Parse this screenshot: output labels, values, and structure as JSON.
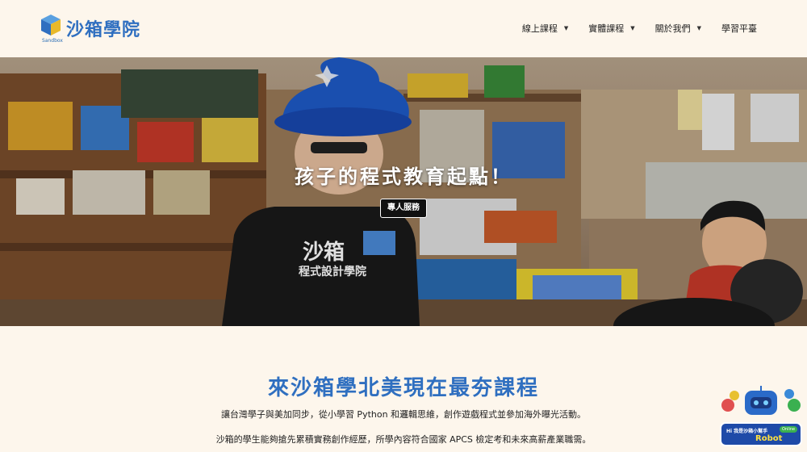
{
  "brand": {
    "name_part1": "沙箱",
    "name_part2": "學院",
    "sub": "Sandbox"
  },
  "nav": [
    {
      "label": "線上課程",
      "caret": true
    },
    {
      "label": "實體課程",
      "caret": true
    },
    {
      "label": "關於我們",
      "caret": true
    },
    {
      "label": "學習平臺",
      "caret": false
    }
  ],
  "hero": {
    "title": "孩子的程式教育起點！",
    "button_label": "專人服務",
    "shirt_line1": "沙箱",
    "shirt_line2": "程式設計學院"
  },
  "section": {
    "title": "來沙箱學北美現在最夯課程",
    "line1": "讓台灣學子與美加同步，從小學習 Python 和邏輯思維，創作遊戲程式並參加海外曝光活動。",
    "line2": "沙箱的學生能夠搶先累積實務創作經歷，所學內容符合國家 APCS 檢定考和未來高薪產業職需。"
  },
  "chat_widget": {
    "greeting": "Hi 我是沙箱小幫手",
    "name": "Robot",
    "badge": "Online"
  },
  "colors": {
    "brand_blue": "#2f6fc0",
    "brand_yellow": "#e8b92a",
    "background": "#fdf6ec"
  }
}
